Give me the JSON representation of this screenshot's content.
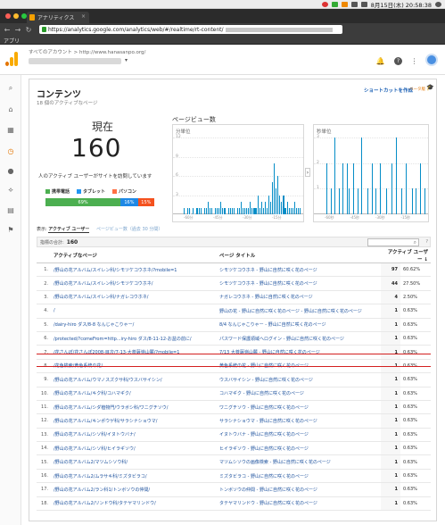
{
  "menubar": {
    "clock": "8月15日(木) 20:58:38"
  },
  "browser": {
    "tab_title": "アナリティクス",
    "url_prefix": "https://analytics.google.com/analytics/web/#/realtime/rt-content/",
    "bookmark": "アプリ"
  },
  "ga": {
    "breadcrumb": "すべてのアカウント > http://www.hanasanpo.org/",
    "account_caret": "▾"
  },
  "rail": {
    "icons": [
      "search-icon",
      "home-icon",
      "dashboard-icon",
      "clock-icon",
      "person-icon",
      "share-icon",
      "table-icon",
      "flag-icon"
    ]
  },
  "content": {
    "title": "コンテンツ",
    "subtitle": "18 個のアクティブなページ",
    "shortcut": "ショートカットを作成",
    "beta": "ベータ版",
    "now_label": "現在",
    "now_value": "160",
    "now_desc": "人のアクティブ ユーザーがサイトを訪問しています",
    "legend": [
      {
        "label": "携帯電話",
        "color": "#4caf50"
      },
      {
        "label": "タブレット",
        "color": "#2196f3"
      },
      {
        "label": "パソコン",
        "color": "#ff7043"
      }
    ],
    "device_split": [
      {
        "label": "69%",
        "value": 69,
        "color": "#4caf50"
      },
      {
        "label": "16%",
        "value": 16,
        "color": "#1e88e5"
      },
      {
        "label": "15%",
        "value": 15,
        "color": "#f4511e"
      }
    ],
    "pageviews_title": "ページビュー数",
    "tab_active": "アクティブ ユーザー",
    "tab_inactive": "ページビュー数（過去 30 分間）",
    "total_label": "指標の合計:",
    "total_value": "160",
    "search_icon": "search-icon",
    "help": "?"
  },
  "chart_data": [
    {
      "type": "bar",
      "title": "分単位",
      "ylabel": "",
      "ytick_labels": [
        "12",
        "9",
        "6",
        "3"
      ],
      "xtick_labels": [
        "-60分",
        "-45分",
        "-30分",
        "-15分"
      ],
      "ylim": [
        0,
        12
      ],
      "values": [
        1,
        0,
        1,
        1,
        0,
        1,
        0,
        1,
        1,
        1,
        0,
        1,
        1,
        2,
        1,
        1,
        0,
        1,
        1,
        1,
        2,
        1,
        1,
        0,
        1,
        1,
        1,
        1,
        0,
        1,
        1,
        2,
        1,
        1,
        1,
        1,
        2,
        1,
        1,
        1,
        3,
        1,
        2,
        1,
        2,
        1,
        3,
        2,
        5,
        8,
        4,
        6,
        3,
        2,
        3,
        1,
        2,
        1,
        1,
        1,
        2,
        1,
        1,
        1
      ]
    },
    {
      "type": "bar",
      "title": "秒単位",
      "ylabel": "",
      "ytick_labels": [
        "3",
        "2",
        "1"
      ],
      "xtick_labels": [
        "-60秒",
        "-45秒",
        "-30秒",
        "-15秒"
      ],
      "ylim": [
        0,
        3
      ],
      "values": [
        0,
        2,
        0,
        0,
        1,
        0,
        3,
        0,
        0,
        1,
        0,
        2,
        0,
        0,
        2,
        1,
        0,
        0,
        2,
        0,
        0,
        1,
        0,
        3,
        0,
        0,
        0,
        1,
        0,
        0,
        2,
        0,
        1,
        0,
        0,
        2,
        0,
        0,
        0,
        1,
        0,
        0,
        2,
        0,
        0,
        3,
        0,
        0,
        1,
        0,
        0,
        2,
        0,
        0,
        0,
        1,
        0,
        1,
        0,
        0,
        2,
        0,
        0,
        1
      ]
    }
  ],
  "table": {
    "headers": [
      "",
      "アクティブなページ",
      "ページ タイトル",
      "アクティブ ユーザー ↓",
      ""
    ],
    "rows": [
      {
        "idx": "1.",
        "page": "/野山の花アルバム/スイレン科/シモツケコウホネ/?mobile=1",
        "title": "シモツケコウホネ - 野山に自然に咲く花のページ",
        "count": "97",
        "pct": "60.62%"
      },
      {
        "idx": "2.",
        "page": "/野山の花アルバム/スイレン科/シモツケコウホネ/",
        "title": "シモツケコウホネ - 野山に自然に咲く花のページ",
        "count": "44",
        "pct": "27.50%"
      },
      {
        "idx": "3.",
        "page": "/野山の花アルバム/スイレン科/ナガレコウホネ/",
        "title": "ナガレコウホネ - 野山に自然に咲く花のページ",
        "count": "4",
        "pct": "2.50%"
      },
      {
        "idx": "4.",
        "page": "/",
        "title": "野山の花 - 野山に自然に咲く花のページ - 野山に自然に咲く花のページ",
        "count": "1",
        "pct": "0.63%"
      },
      {
        "idx": "5.",
        "page": "/dairy-hiro ダス/8-8 なんじゃこりゃー/",
        "title": "8/4 なんじゃこりゃー - 野山に自然に咲く花のページ",
        "count": "1",
        "pct": "0.63%"
      },
      {
        "idx": "6.",
        "page": "/protected/?comeFrom=http...iry-hiro ダス/8-11-12-お盆の前に/",
        "title": "パスワード保護領域へログイン - 野山に自然に咲く花のページ",
        "count": "1",
        "pct": "0.63%"
      },
      {
        "idx": "7.",
        "page": "/花さんぽ/花さんぽ2008-目次/7-13-大菩薩嶺山麓/?mobile=1",
        "title": "7/13 大菩薩嶺山麓 - 野山に自然に咲く花のページ",
        "count": "1",
        "pct": "0.63%"
      },
      {
        "idx": "8.",
        "page": "/花色検索/黄色系統の花/",
        "title": "黄色系統の花 - 野山に自然に咲く花のページ",
        "count": "1",
        "pct": "0.63%"
      },
      {
        "idx": "9.",
        "page": "/野山の花アルバム/ウマノスズクサ科/ウスバサイシン/",
        "title": "ウスバサイシン - 野山に自然に咲く花のページ",
        "count": "1",
        "pct": "0.63%"
      },
      {
        "idx": "10.",
        "page": "/野山の花アルバム/キク科/コハマギク/",
        "title": "コハマギク - 野山に自然に咲く花のページ",
        "count": "1",
        "pct": "0.63%"
      },
      {
        "idx": "11.",
        "page": "/野山の花アルバム/シダ植物門/ウラボシ科/ワニグチソウ/",
        "title": "ワニグチソウ - 野山に自然に咲く花のページ",
        "count": "1",
        "pct": "0.63%"
      },
      {
        "idx": "12.",
        "page": "/野山の花アルバム/キンポウゲ科/サラシナショウマ/",
        "title": "サラシナショウマ - 野山に自然に咲く花のページ",
        "count": "1",
        "pct": "0.63%"
      },
      {
        "idx": "13.",
        "page": "/野山の花アルバム/シソ科/イヌトウバナ/",
        "title": "イヌトウバナ - 野山に自然に咲く花のページ",
        "count": "1",
        "pct": "0.63%"
      },
      {
        "idx": "14.",
        "page": "/野山の花アルバム/シソ科/ヒイラギソウ/",
        "title": "ヒイラギソウ - 野山に自然に咲く花のページ",
        "count": "1",
        "pct": "0.63%"
      },
      {
        "idx": "15.",
        "page": "/野山の花アルバム2/マツムシソウ科/",
        "title": "マツムシソウの画像検索 - 野山に自然に咲く花のページ",
        "count": "1",
        "pct": "0.63%"
      },
      {
        "idx": "16.",
        "page": "/野山の花アルバム2/ムラサキ科/ミズタビラコ/",
        "title": "ミズタビラコ - 野山に自然に咲く花のページ",
        "count": "1",
        "pct": "0.63%"
      },
      {
        "idx": "17.",
        "page": "/野山の花アルバム2/ラン科1/トンボソウの仲間/",
        "title": "トンボソウの仲間 - 野山に自然に咲く花のページ",
        "count": "1",
        "pct": "0.63%"
      },
      {
        "idx": "18.",
        "page": "/野山の花アルバム2/リンドウ科/タテヤマリンドウ/",
        "title": "タテヤマリンドウ - 野山に自然に咲く花のページ",
        "count": "1",
        "pct": "0.63%"
      }
    ]
  }
}
